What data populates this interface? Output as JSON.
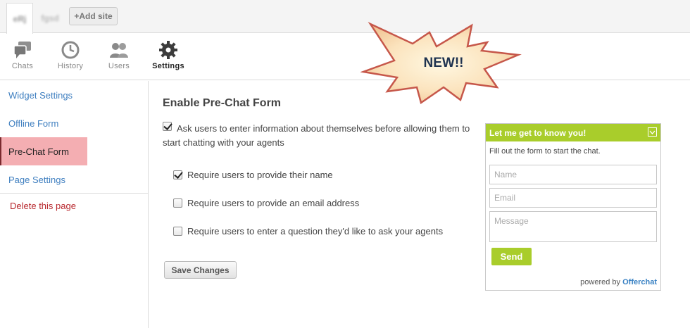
{
  "sites": {
    "tabs": [
      {
        "label": "eRj"
      },
      {
        "label": "fgsd"
      }
    ],
    "add_site_label": "+Add site"
  },
  "nav": {
    "items": [
      {
        "label": "Chats",
        "icon": "chats-icon"
      },
      {
        "label": "History",
        "icon": "clock-icon"
      },
      {
        "label": "Users",
        "icon": "users-icon"
      },
      {
        "label": "Settings",
        "icon": "gear-icon",
        "active": true
      }
    ]
  },
  "badge": {
    "label": "NEW!!"
  },
  "sidebar": {
    "items": [
      {
        "label": "Widget Settings"
      },
      {
        "label": "Offline Form"
      },
      {
        "label": "Pre-Chat Form",
        "active": true
      },
      {
        "label": "Page Settings"
      }
    ],
    "delete_label": "Delete this page"
  },
  "form": {
    "title": "Enable Pre-Chat Form",
    "main_option": {
      "label": "Ask users to enter information about themselves before allowing them to start chatting with your agents",
      "checked": true
    },
    "options": [
      {
        "label": "Require users to provide their name",
        "checked": true
      },
      {
        "label": "Require users to provide an email address",
        "checked": false
      },
      {
        "label": "Require users to enter a question they'd like to ask your agents",
        "checked": false
      }
    ],
    "save_label": "Save Changes"
  },
  "widget": {
    "title": "Let me get to know you!",
    "intro": "Fill out the form to start the chat.",
    "name_placeholder": "Name",
    "email_placeholder": "Email",
    "message_placeholder": "Message",
    "send_label": "Send",
    "powered_by": "powered by",
    "brand": "Offerchat"
  },
  "colors": {
    "accent_green": "#a9cd2b",
    "link_blue": "#3f7fc0",
    "active_pink": "#f4aeb2",
    "delete_red": "#b8282e"
  }
}
